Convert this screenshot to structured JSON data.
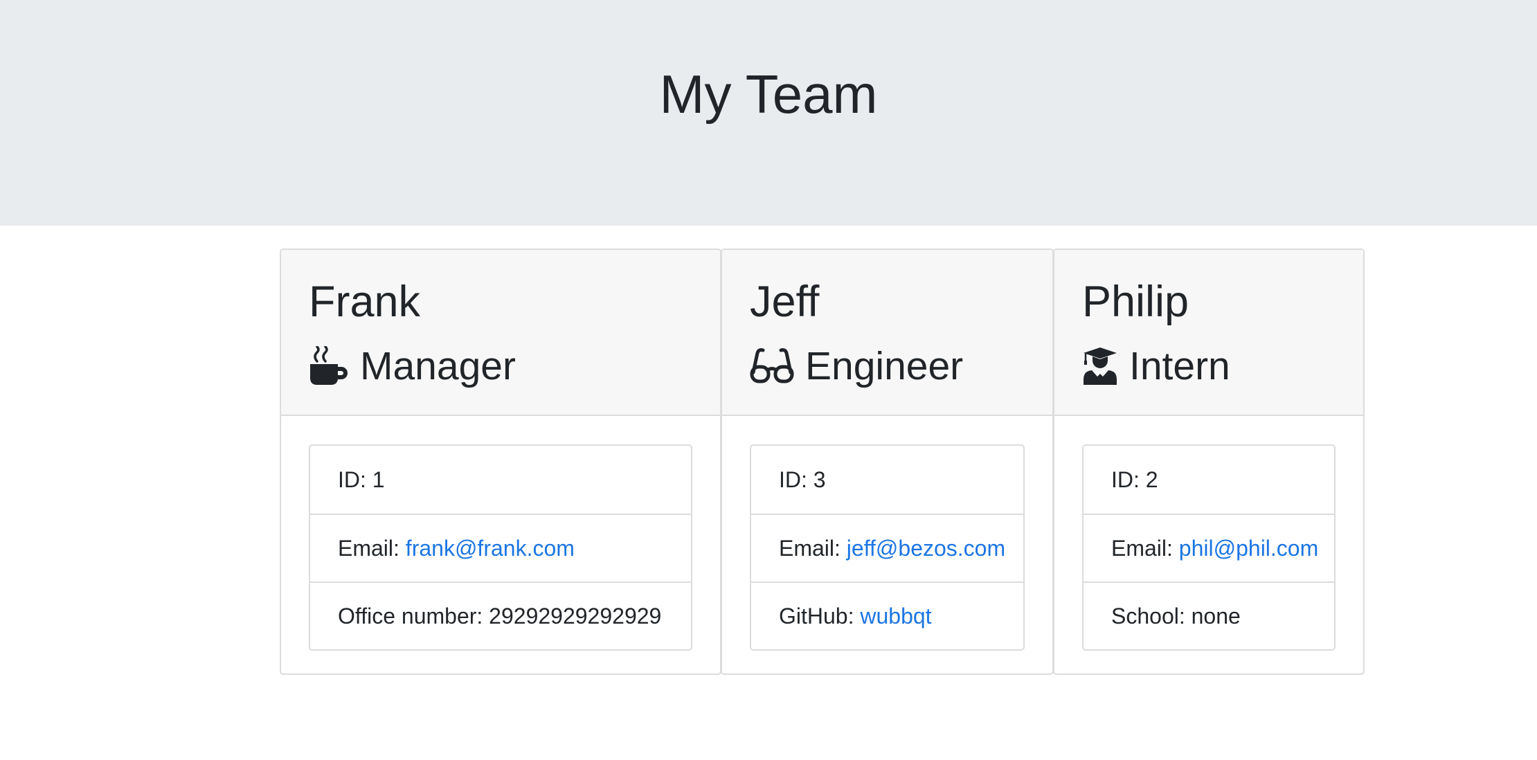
{
  "header": {
    "title": "My Team"
  },
  "team": [
    {
      "name": "Frank",
      "role": "Manager",
      "icon": "mug-hot-icon",
      "id_label": "ID:",
      "id": "1",
      "email_label": "Email:",
      "email": "frank@frank.com",
      "extra_label": "Office number:",
      "extra_value": "29292929292929"
    },
    {
      "name": "Jeff",
      "role": "Engineer",
      "icon": "glasses-icon",
      "id_label": "ID:",
      "id": "3",
      "email_label": "Email:",
      "email": "jeff@bezos.com",
      "extra_label": "GitHub:",
      "extra_value": "wubbqt"
    },
    {
      "name": "Philip",
      "role": "Intern",
      "icon": "user-graduate-icon",
      "id_label": "ID:",
      "id": "2",
      "email_label": "Email:",
      "email": "phil@phil.com",
      "extra_label": "School:",
      "extra_value": "none"
    }
  ],
  "colors": {
    "jumbotron_bg": "#e9ecef",
    "card_header_bg": "#f7f7f7",
    "link": "#1b75e3",
    "text": "#212529"
  }
}
